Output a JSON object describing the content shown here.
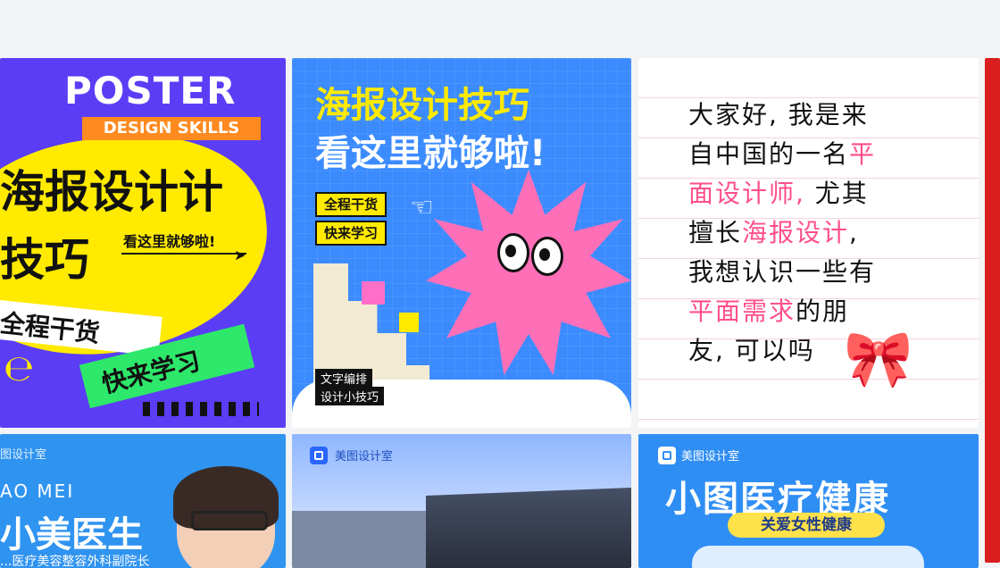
{
  "cards": [
    {
      "poster": "POSTER",
      "skills": "DESIGN SKILLS",
      "title_line1": "海报设计计",
      "title_line2": "技巧",
      "side": "看这里就够啦!",
      "banner1": "全程干货",
      "banner2": "快来学习"
    },
    {
      "h1": "海报设计技巧",
      "h2": "看这里就够啦!",
      "tag1": "全程干货",
      "tag2": "快来学习",
      "cap1": "文字编排",
      "cap2": "设计小技巧"
    },
    {
      "lines": [
        [
          "大家好, 我是来",
          ""
        ],
        [
          "自中国的一名",
          "平"
        ],
        [
          "",
          "面设计师,",
          " 尤其"
        ],
        [
          "擅长",
          "海报设计",
          ","
        ],
        [
          "我想认识一些有",
          ""
        ],
        [
          "",
          "平面需求",
          "的朋"
        ],
        [
          "友, 可以吗",
          ""
        ]
      ]
    },
    {
      "brand": "图设计室",
      "en": "AO MEI",
      "name": "小美医生",
      "sub": "...医疗美容整容外科副院长"
    },
    {
      "brand": "美图设计室"
    },
    {
      "brand": "美图设计室",
      "title": "小图医疗健康",
      "pill": "关爱女性健康"
    }
  ],
  "colors": {
    "card1_bg": "#5b3df5",
    "card2_bg": "#3b8bff",
    "accent_yellow": "#ffea00",
    "accent_pink": "#ff4f8a",
    "card6_bg": "#2f8ef3"
  }
}
